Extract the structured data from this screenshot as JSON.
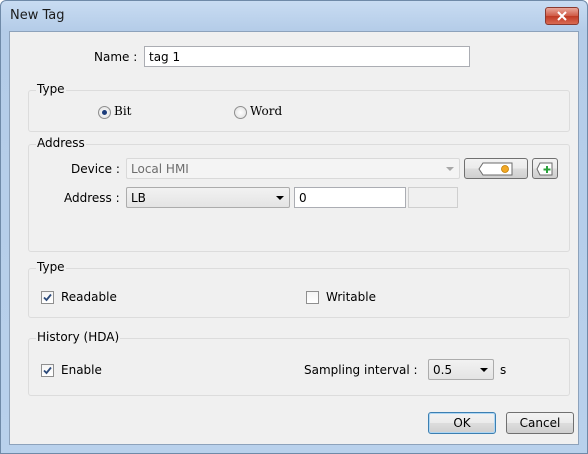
{
  "window": {
    "title": "New Tag"
  },
  "name_field": {
    "label": "Name :",
    "value": "tag 1"
  },
  "type_group": {
    "title": "Type",
    "options": [
      {
        "label": "Bit",
        "selected": true
      },
      {
        "label": "Word",
        "selected": false
      }
    ]
  },
  "address_group": {
    "title": "Address",
    "device_label": "Device :",
    "device_value": "Local HMI",
    "address_label": "Address :",
    "address_type": "LB",
    "address_value": "0",
    "address_extra": ""
  },
  "access_group": {
    "title": "Type",
    "readable_label": "Readable",
    "readable_checked": true,
    "writable_label": "Writable",
    "writable_checked": false
  },
  "history_group": {
    "title": "History (HDA)",
    "enable_label": "Enable",
    "enable_checked": true,
    "interval_label": "Sampling interval :",
    "interval_value": "0.5",
    "interval_unit": "s"
  },
  "buttons": {
    "ok": "OK",
    "cancel": "Cancel"
  },
  "colors": {
    "title_bar": "#b9d1ec",
    "dialog_bg": "#f0f0f0",
    "close_button": "#c7432c",
    "default_button_border": "#3c7fb1"
  }
}
